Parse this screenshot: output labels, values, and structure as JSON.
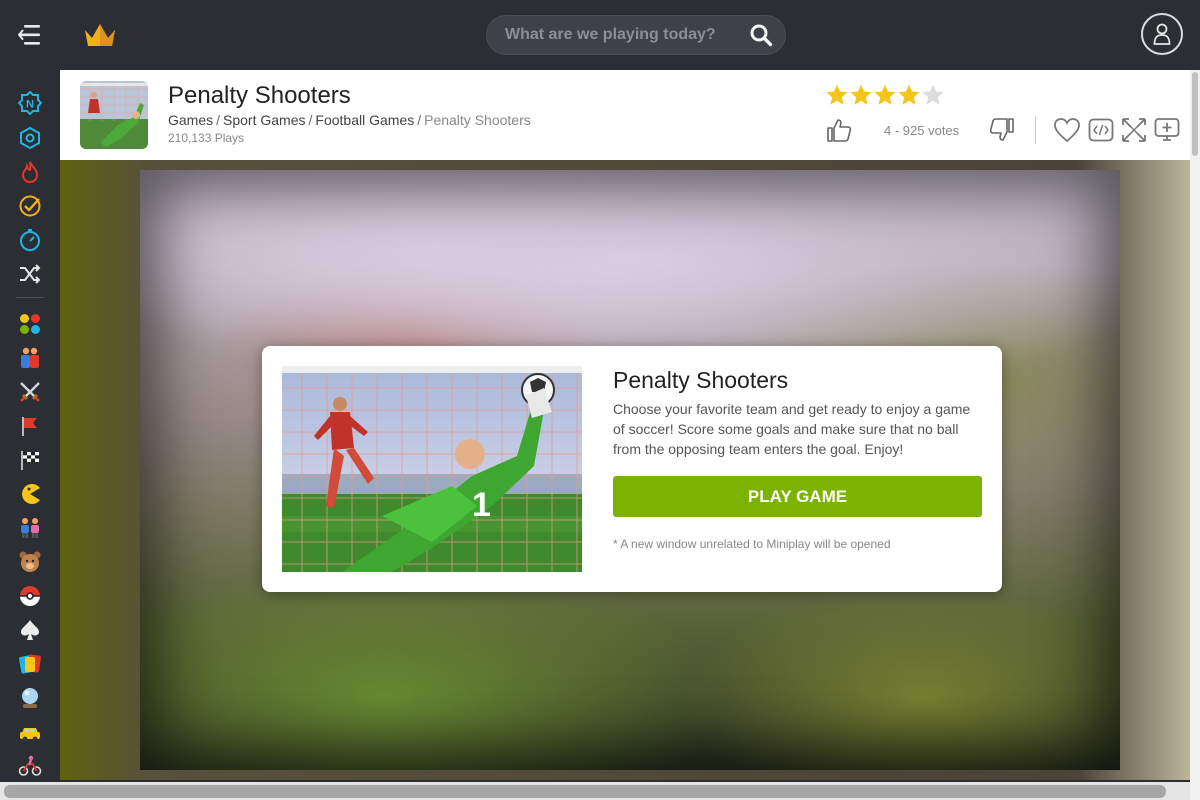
{
  "topbar": {
    "search_placeholder": "What are we playing today?",
    "logo_icon": "crown-icon",
    "accent_color": "#f2b01e"
  },
  "sidebar": {
    "items": [
      {
        "name": "new-games",
        "icon": "n-badge-icon"
      },
      {
        "name": "popular",
        "icon": "hexagon-icon"
      },
      {
        "name": "hot",
        "icon": "flame-icon"
      },
      {
        "name": "best",
        "icon": "check-badge-icon"
      },
      {
        "name": "recent",
        "icon": "stopwatch-icon"
      },
      {
        "name": "random",
        "icon": "shuffle-icon"
      },
      {
        "name": "all-categories",
        "icon": "color-dots-icon"
      },
      {
        "name": "two-player",
        "icon": "wrestlers-icon"
      },
      {
        "name": "action",
        "icon": "crossed-swords-icon"
      },
      {
        "name": "strategy",
        "icon": "flag-icon"
      },
      {
        "name": "racing",
        "icon": "checkered-flag-icon"
      },
      {
        "name": "arcade",
        "icon": "pacman-icon"
      },
      {
        "name": "kids",
        "icon": "children-icon"
      },
      {
        "name": "girls",
        "icon": "teddy-bear-icon"
      },
      {
        "name": "pokemon",
        "icon": "pokeball-icon"
      },
      {
        "name": "cards",
        "icon": "spade-icon"
      },
      {
        "name": "card-games",
        "icon": "playing-cards-icon"
      },
      {
        "name": "puzzle",
        "icon": "crystal-ball-icon"
      },
      {
        "name": "cars",
        "icon": "taxi-icon"
      },
      {
        "name": "bike",
        "icon": "cyclist-icon"
      }
    ]
  },
  "game": {
    "title": "Penalty Shooters",
    "breadcrumb": [
      "Games",
      "Sport Games",
      "Football Games",
      "Penalty Shooters"
    ],
    "plays": "210,133 Plays",
    "rating": 4,
    "rating_max": 5,
    "votes": "4 - 925 votes",
    "star_color": "#f5c518"
  },
  "actions": [
    "heart-icon",
    "embed-code-icon",
    "fullscreen-icon",
    "add-to-screen-icon"
  ],
  "modal": {
    "title": "Penalty Shooters",
    "description": "Choose your favorite team and get ready to enjoy a game of soccer! Score some goals and make sure that no ball from the opposing team enters the goal. Enjoy!",
    "play_label": "PLAY GAME",
    "note": "* A new window unrelated to Miniplay will be opened",
    "button_color": "#7cb300"
  }
}
